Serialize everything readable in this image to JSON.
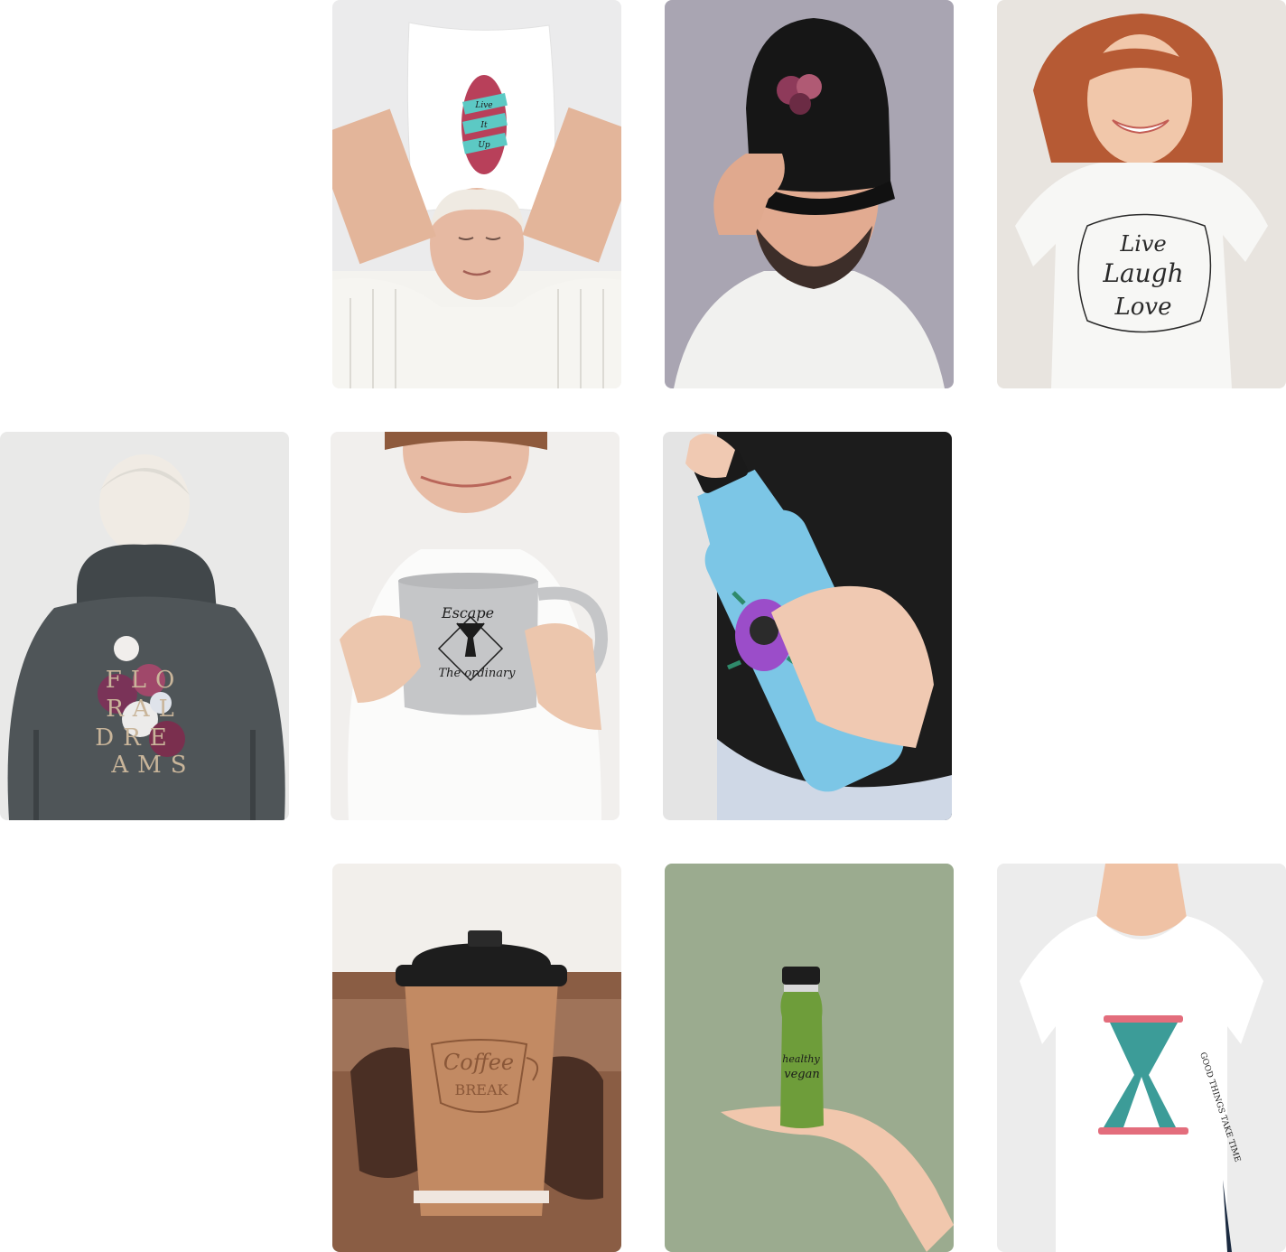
{
  "gallery": {
    "items": [
      {
        "id": "pillow",
        "product": "pillow",
        "design_text": [
          "Live",
          "It",
          "Up"
        ],
        "colors": {
          "bg": "#ebebec",
          "design": "#5cc9c4",
          "accent": "#b8405a"
        }
      },
      {
        "id": "cap",
        "product": "cap",
        "design_text": [],
        "colors": {
          "bg": "#a9a5b2",
          "product": "#161616",
          "design": "#8e3a5a"
        }
      },
      {
        "id": "tshirt-live-laugh-love",
        "product": "t-shirt",
        "design_text": [
          "Live",
          "Laugh",
          "Love"
        ],
        "colors": {
          "bg": "#e8e4df",
          "product": "#f7f7f5",
          "design": "#2a2a2a"
        }
      },
      {
        "id": "hoodie",
        "product": "hoodie",
        "design_text": [
          "FLO",
          "RAL",
          "DRE",
          "AMS"
        ],
        "colors": {
          "bg": "#e9e9e8",
          "product": "#4f5558",
          "design": "#c9b59a"
        }
      },
      {
        "id": "mug",
        "product": "mug",
        "design_text": [
          "Escape",
          "The ordinary"
        ],
        "colors": {
          "bg": "#f1efed",
          "product": "#c5c6c8",
          "design": "#1c1c1c"
        }
      },
      {
        "id": "water-bottle",
        "product": "water bottle",
        "design_text": [],
        "colors": {
          "bg": "#1c1c1c",
          "product": "#7cc6e6",
          "design": "#9b4dc9"
        }
      },
      {
        "id": "coffee-cup",
        "product": "coffee cup",
        "design_text": [
          "Coffee",
          "BREAK"
        ],
        "colors": {
          "bg": "#8a5d44",
          "product": "#c28a63",
          "lid": "#1d1d1d"
        }
      },
      {
        "id": "juice-bottle",
        "product": "juice bottle",
        "design_text": [
          "healthy",
          "vegan"
        ],
        "colors": {
          "bg": "#9bab8f",
          "product": "#6e9d3a",
          "lid": "#1d1d1d"
        }
      },
      {
        "id": "tshirt-hourglass",
        "product": "t-shirt",
        "design_text": [
          "GOOD THINGS TAKE TIME"
        ],
        "colors": {
          "bg": "#ececec",
          "product": "#ffffff",
          "design": "#3c9c98",
          "accent": "#e36d7c"
        }
      }
    ]
  }
}
